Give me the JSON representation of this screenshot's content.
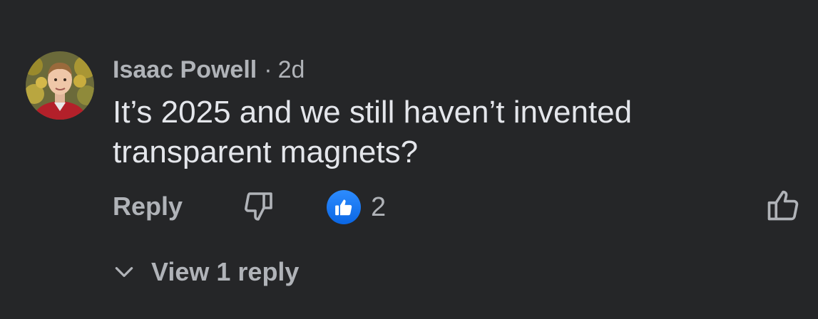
{
  "comment": {
    "author": "Isaac Powell",
    "separator": "·",
    "timestamp": "2d",
    "text": "It’s 2025 and we still haven’t invented transparent magnets?",
    "avatar_icon": "profile-photo"
  },
  "actions": {
    "reply_label": "Reply",
    "dislike_icon": "thumbs-down-outline-icon",
    "reaction_icon": "like-reaction-icon",
    "reaction_count": "2",
    "like_icon": "thumbs-up-outline-icon"
  },
  "replies": {
    "view_label": "View 1 reply",
    "toggle_icon": "chevron-down-icon"
  },
  "colors": {
    "background": "#252628",
    "primary_text": "#e4e6eb",
    "secondary_text": "#b0b3b8",
    "like_blue": "#1877f2"
  }
}
